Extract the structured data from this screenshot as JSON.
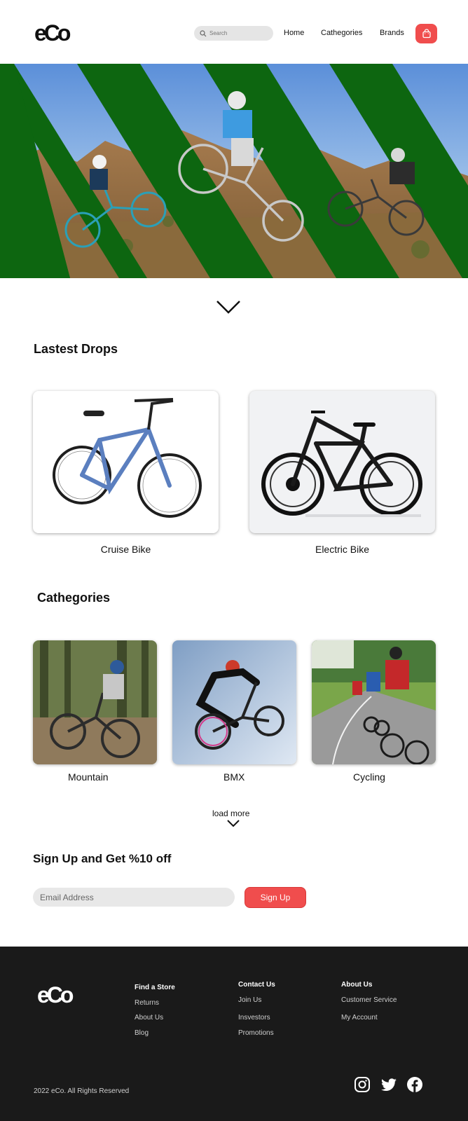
{
  "brand": {
    "logo_text": "eCo"
  },
  "header": {
    "search_placeholder": "Search",
    "nav": [
      "Home",
      "Cathegories",
      "Brands"
    ]
  },
  "latest": {
    "title": "Lastest Drops",
    "products": [
      {
        "name": "Cruise Bike"
      },
      {
        "name": "Electric Bike"
      }
    ]
  },
  "categories": {
    "title": "Cathegories",
    "items": [
      {
        "name": "Mountain"
      },
      {
        "name": "BMX"
      },
      {
        "name": "Cycling"
      }
    ],
    "load_more": "load more"
  },
  "signup": {
    "title": "Sign Up and Get %10 off",
    "email_placeholder": "Email Address",
    "button": "Sign Up"
  },
  "footer": {
    "columns": [
      {
        "items": [
          "Find a Store",
          "Returns",
          "About Us",
          "Blog"
        ]
      },
      {
        "items": [
          "Contact Us",
          "Join Us",
          "Insvestors",
          "Promotions"
        ]
      },
      {
        "items": [
          "About Us",
          "Customer Service",
          "My Account"
        ]
      }
    ],
    "copyright": "2022 eCo. All Rights Reserved"
  },
  "colors": {
    "accent": "#f04d4d",
    "hero_green": "#0d6610",
    "footer_bg": "#1a1a1a"
  }
}
